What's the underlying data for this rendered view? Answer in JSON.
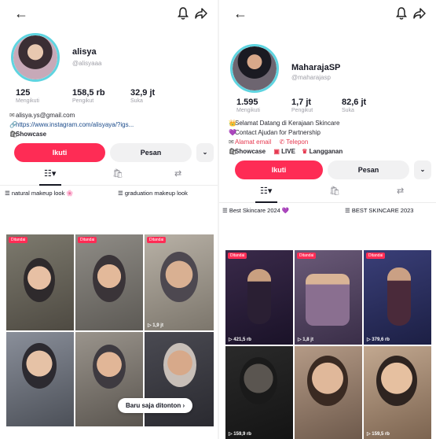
{
  "left": {
    "username": "alisya",
    "handle": "@alisyaaa",
    "stats": [
      {
        "num": "125",
        "label": "Mengikuti"
      },
      {
        "num": "158,5 rb",
        "label": "Pengikut"
      },
      {
        "num": "32,9 jt",
        "label": "Suka"
      }
    ],
    "email": "alisya.ys@gmail.com",
    "link": "https://www.instagram.com/alisyaya/?igs...",
    "showcase": "Showcase",
    "follow": "Ikuti",
    "message": "Pesan",
    "more": "⌄",
    "playlists": [
      "natural makeup look 🌸",
      "graduation makeup look"
    ],
    "cells": [
      {
        "tag": "Ditandai",
        "views": ""
      },
      {
        "tag": "Ditandai",
        "views": ""
      },
      {
        "tag": "Ditandai",
        "views": "▷ 1,9 jt"
      },
      {
        "tag": "",
        "views": ""
      },
      {
        "tag": "",
        "views": ""
      },
      {
        "tag": "",
        "views": ""
      }
    ],
    "toast": "Baru saja ditonton ›"
  },
  "right": {
    "username": "MaharajaSP",
    "handle": "@maharajasp",
    "stats": [
      {
        "num": "1.595",
        "label": "Mengikuti"
      },
      {
        "num": "1,7 jt",
        "label": "Pengikut"
      },
      {
        "num": "82,6 jt",
        "label": "Suka"
      }
    ],
    "bio1": "Selamat Datang di Kerajaan Skincare",
    "bio2": "Contact Ajudan for Partnership",
    "email_label": "Alamat email",
    "phone_label": "Telepon",
    "showcase": "Showcase",
    "live": "LIVE",
    "subscribe": "Langganan",
    "follow": "Ikuti",
    "message": "Pesan",
    "more": "⌄",
    "playlists": [
      "Best Skincare 2024 💜",
      "BEST SKINCARE 2023"
    ],
    "cells": [
      {
        "tag": "Ditandai",
        "views": "▷ 421,5 rb"
      },
      {
        "tag": "Ditandai",
        "views": "▷ 1,8 jt"
      },
      {
        "tag": "Ditandai",
        "views": "▷ 379,6 rb"
      },
      {
        "tag": "",
        "views": "▷ 159,9 rb"
      },
      {
        "tag": "",
        "views": ""
      },
      {
        "tag": "",
        "views": "▷ 159,5 rb"
      }
    ]
  },
  "colors": {
    "accent": "#fe2c55",
    "ring": "#5fd4e0"
  },
  "icons": {
    "back": "←",
    "bell": "bell-icon",
    "share": "share-icon"
  }
}
